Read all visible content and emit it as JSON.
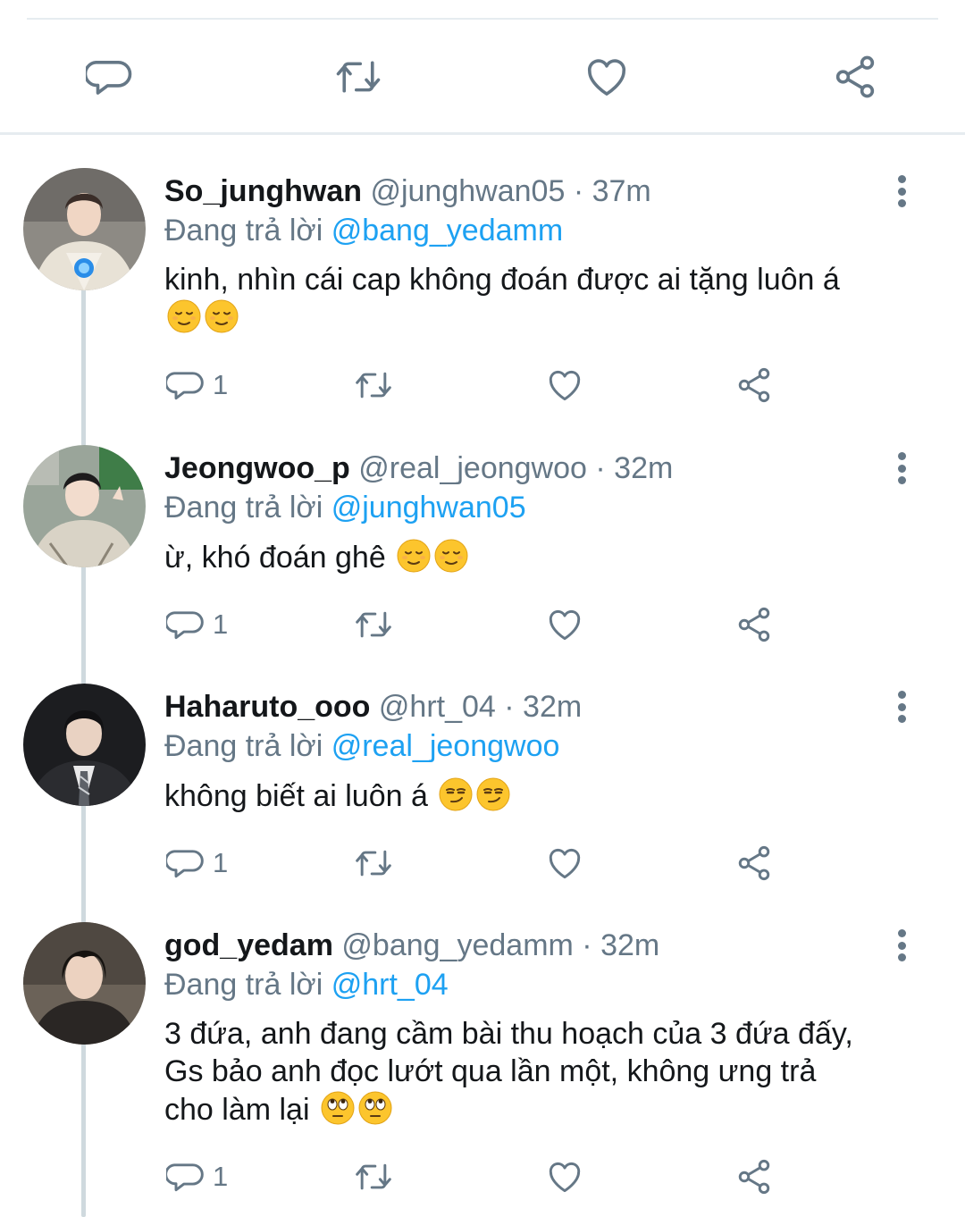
{
  "top_actions": {
    "reply_icon": "reply-icon",
    "retweet_icon": "retweet-icon",
    "like_icon": "heart-icon",
    "share_icon": "share-icon"
  },
  "colors": {
    "text": "#14171a",
    "muted": "#657786",
    "link": "#1da1f2",
    "divider": "#e6ecf0",
    "thread_line": "#cfd9de"
  },
  "replies": [
    {
      "name": "So_junghwan",
      "handle": "@junghwan05",
      "time": "· 37m",
      "replying_prefix": "Đang trả lời",
      "replying_to": "@bang_yedamm",
      "lines": [
        "kinh, nhìn cái cap không đoán được ai tặng luôn á",
        ""
      ],
      "emoji": "relieved-face",
      "reply_count": "1"
    },
    {
      "name": "Jeongwoo_p",
      "handle": "@real_jeongwoo",
      "time": "· 32m",
      "replying_prefix": "Đang trả lời",
      "replying_to": "@junghwan05",
      "lines": [
        "ừ, khó đoán ghê"
      ],
      "emoji": "relieved-face",
      "reply_count": "1"
    },
    {
      "name": "Haharuto_ooo",
      "handle": "@hrt_04",
      "time": "· 32m",
      "replying_prefix": "Đang trả lời",
      "replying_to": "@real_jeongwoo",
      "lines": [
        "không biết ai luôn á"
      ],
      "emoji": "smirking-face",
      "reply_count": "1"
    },
    {
      "name": "god_yedam",
      "handle": "@bang_yedamm",
      "time": "· 32m",
      "replying_prefix": "Đang trả lời",
      "replying_to": "@hrt_04",
      "lines": [
        "3 đứa, anh đang cầm bài thu hoạch của 3 đứa đấy,",
        "Gs bảo anh đọc lướt qua lần một, không ưng trả",
        "cho làm lại"
      ],
      "emoji": "face-with-rolling-eyes",
      "reply_count": "1"
    }
  ]
}
